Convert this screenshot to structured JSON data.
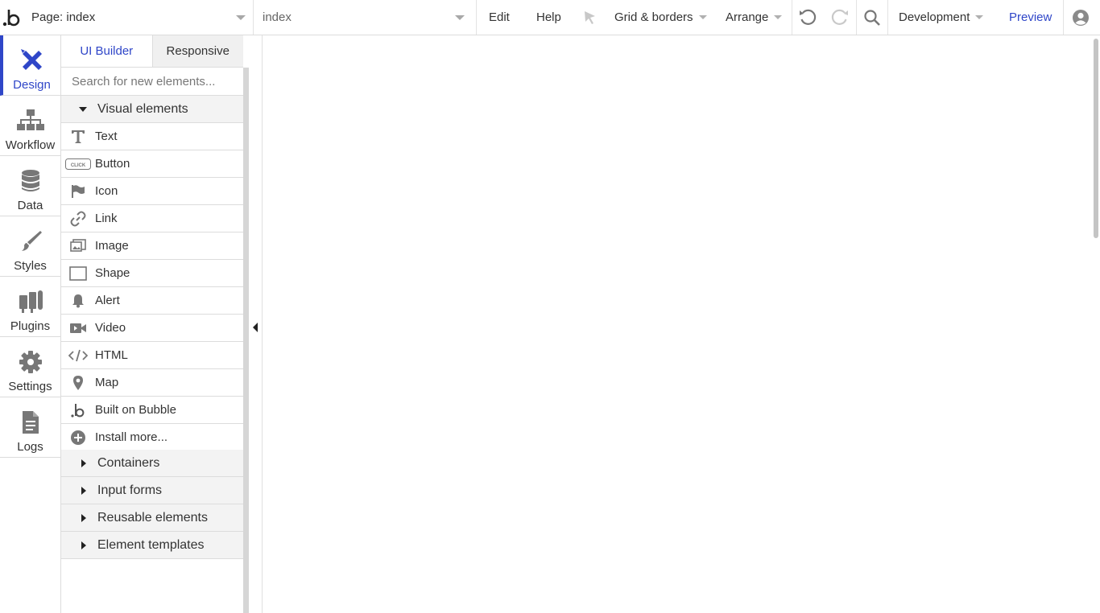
{
  "topbar": {
    "page_label": "Page: index",
    "element_label": "index",
    "edit": "Edit",
    "help": "Help",
    "grid": "Grid & borders",
    "arrange": "Arrange",
    "environment": "Development",
    "preview": "Preview"
  },
  "leftnav": {
    "items": [
      {
        "label": "Design",
        "icon": "design-icon",
        "active": true
      },
      {
        "label": "Workflow",
        "icon": "workflow-icon"
      },
      {
        "label": "Data",
        "icon": "database-icon"
      },
      {
        "label": "Styles",
        "icon": "brush-icon"
      },
      {
        "label": "Plugins",
        "icon": "plugin-icon"
      },
      {
        "label": "Settings",
        "icon": "gear-icon"
      },
      {
        "label": "Logs",
        "icon": "document-icon"
      }
    ]
  },
  "palette": {
    "tabs": [
      "UI Builder",
      "Responsive"
    ],
    "search_placeholder": "Search for new elements...",
    "visual_category": "Visual elements",
    "visual_items": [
      {
        "label": "Text",
        "icon": "text-icon"
      },
      {
        "label": "Button",
        "icon": "button-icon",
        "icon_text": "CLICK"
      },
      {
        "label": "Icon",
        "icon": "flag-icon"
      },
      {
        "label": "Link",
        "icon": "link-icon"
      },
      {
        "label": "Image",
        "icon": "image-icon"
      },
      {
        "label": "Shape",
        "icon": "shape-icon"
      },
      {
        "label": "Alert",
        "icon": "bell-icon"
      },
      {
        "label": "Video",
        "icon": "video-icon"
      },
      {
        "label": "HTML",
        "icon": "code-icon"
      },
      {
        "label": "Map",
        "icon": "map-pin-icon"
      },
      {
        "label": "Built on Bubble",
        "icon": "bubble-icon"
      },
      {
        "label": "Install more...",
        "icon": "plus-circle-icon"
      }
    ],
    "collapsed_categories": [
      "Containers",
      "Input forms",
      "Reusable elements",
      "Element templates"
    ]
  },
  "colors": {
    "accent": "#2f46c8",
    "icon_gray": "#777777",
    "border": "#dcdcdc"
  }
}
